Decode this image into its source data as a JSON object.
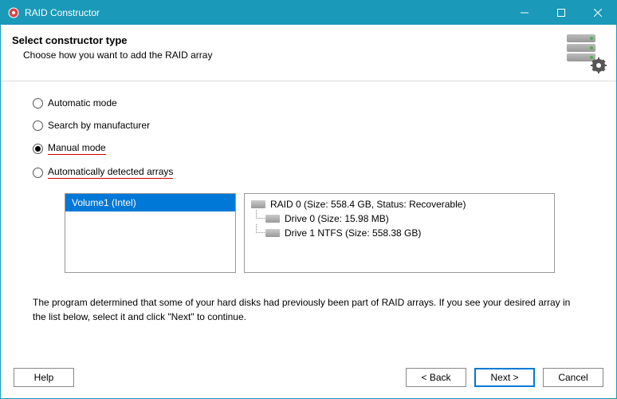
{
  "titlebar": {
    "title": "RAID Constructor"
  },
  "header": {
    "title": "Select constructor type",
    "subtitle": "Choose how you want to add the RAID array"
  },
  "options": {
    "automatic": "Automatic mode",
    "search": "Search by manufacturer",
    "manual": "Manual mode",
    "auto_detected": "Automatically detected arrays"
  },
  "volumes": {
    "item0": "Volume1 (Intel)"
  },
  "tree": {
    "root": "RAID 0 (Size: 558.4 GB, Status: Recoverable)",
    "child0": "Drive 0 (Size: 15.98 MB)",
    "child1": "Drive 1 NTFS (Size: 558.38 GB)"
  },
  "description": "The program determined that some of your hard disks had previously been part of RAID arrays. If you see your desired array in the list below, select it and click \"Next\" to continue.",
  "buttons": {
    "help": "Help",
    "back": "< Back",
    "next": "Next >",
    "cancel": "Cancel"
  }
}
